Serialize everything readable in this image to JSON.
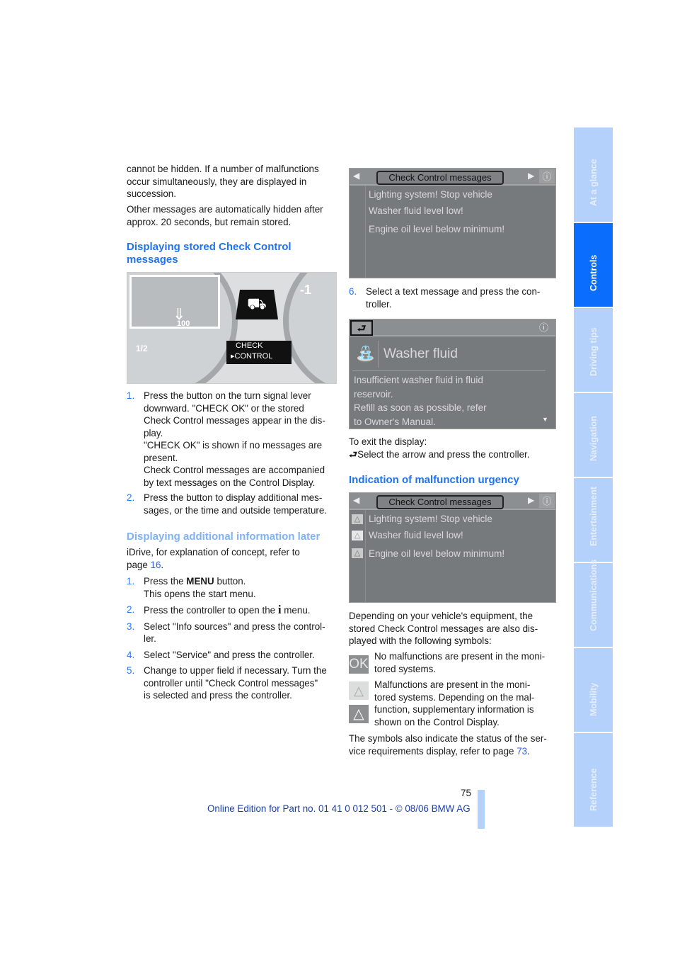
{
  "left": {
    "p1": [
      "cannot be hidden. If a number of malfunctions",
      "occur simultaneously, they are displayed in",
      "succession."
    ],
    "p2": [
      "Other messages are automatically hidden after",
      "approx. 20 seconds, but remain stored."
    ],
    "heading1": [
      "Displaying stored Check Control",
      "messages"
    ],
    "image1": {
      "display_line1": "CHECK",
      "display_line2": "▸CONTROL",
      "gauge_half": "1/2",
      "gauge_minus1": "-1",
      "gauge_100": "100"
    },
    "steps1": [
      {
        "n": "1.",
        "lines": [
          "Press the button on the turn signal lever",
          "downward. \"CHECK OK\" or the stored",
          "Check Control messages appear in the dis-",
          "play.",
          "\"CHECK OK\" is shown if no messages are",
          "present.",
          "Check Control messages are accompanied",
          "by text messages on the Control Display."
        ]
      },
      {
        "n": "2.",
        "lines": [
          "Press the button to display additional mes-",
          "sages, or the time and outside temperature."
        ]
      }
    ],
    "heading2": "Displaying additional information later",
    "idrive": {
      "line1": "iDrive, for explanation of concept, refer to",
      "line2_prefix": "page ",
      "page_link": "16",
      "line2_suffix": "."
    },
    "steps2": {
      "s1": {
        "n": "1.",
        "pre": "Press the ",
        "bold": "MENU",
        "post": " button.",
        "line2": "This opens the start menu."
      },
      "s2": {
        "n": "2.",
        "pre": "Press the controller to open the ",
        "icon": "i",
        "post": " menu."
      },
      "s3": {
        "n": "3.",
        "lines": [
          "Select \"Info sources\" and press the control-",
          "ler."
        ]
      },
      "s4": {
        "n": "4.",
        "lines": [
          "Select \"Service\" and press the controller."
        ]
      },
      "s5": {
        "n": "5.",
        "lines": [
          "Change to upper field if necessary. Turn the",
          "controller until \"Check Control messages\"",
          "is selected and press the controller."
        ]
      }
    }
  },
  "right": {
    "screen1": {
      "title": "Check Control messages",
      "messages": [
        "Lighting system! Stop vehicle",
        "Washer fluid level low!",
        "Engine oil level below minimum!"
      ]
    },
    "step6": {
      "n": "6.",
      "lines": [
        "Select a text message and press the con-",
        "troller."
      ]
    },
    "screen2": {
      "title": "Washer fluid",
      "lines": [
        "Insufficient washer fluid in fluid",
        "reservoir.",
        "Refill as soon as possible, refer",
        "to Owner's Manual."
      ]
    },
    "exit": {
      "line1": "To exit the display:",
      "line2": "Select the arrow and press the controller."
    },
    "heading3": "Indication of malfunction urgency",
    "screen3": {
      "title": "Check Control messages",
      "messages": [
        "Lighting system! Stop vehicle",
        "Washer fluid level low!",
        "Engine oil level below minimum!"
      ]
    },
    "p_symbols": [
      "Depending on your vehicle's equipment, the",
      "stored Check Control messages are also dis-",
      "played with the following symbols:"
    ],
    "ok_symbol": "OK",
    "ok_text": [
      "No malfunctions are present in the moni-",
      "tored systems."
    ],
    "warn_text": [
      "Malfunctions are present in the moni-",
      "tored systems. Depending on the mal-",
      "function, supplementary information is",
      "shown on the Control Display."
    ],
    "status": {
      "line1": "The symbols also indicate the status of the ser-",
      "line2_prefix": "vice requirements display, refer to page ",
      "page_link": "73",
      "line2_suffix": "."
    }
  },
  "sidebar": {
    "tabs": [
      "At a glance",
      "Controls",
      "Driving tips",
      "Navigation",
      "Entertainment",
      "Communications",
      "Mobility",
      "Reference"
    ],
    "active": "Controls",
    "active_color": "#0a6dfb",
    "inactive_color": "#b3d1fb"
  },
  "footer": {
    "page_number": "75",
    "edition": "Online Edition for Part no. 01 41 0 012 501 - © 08/06 BMW AG"
  }
}
